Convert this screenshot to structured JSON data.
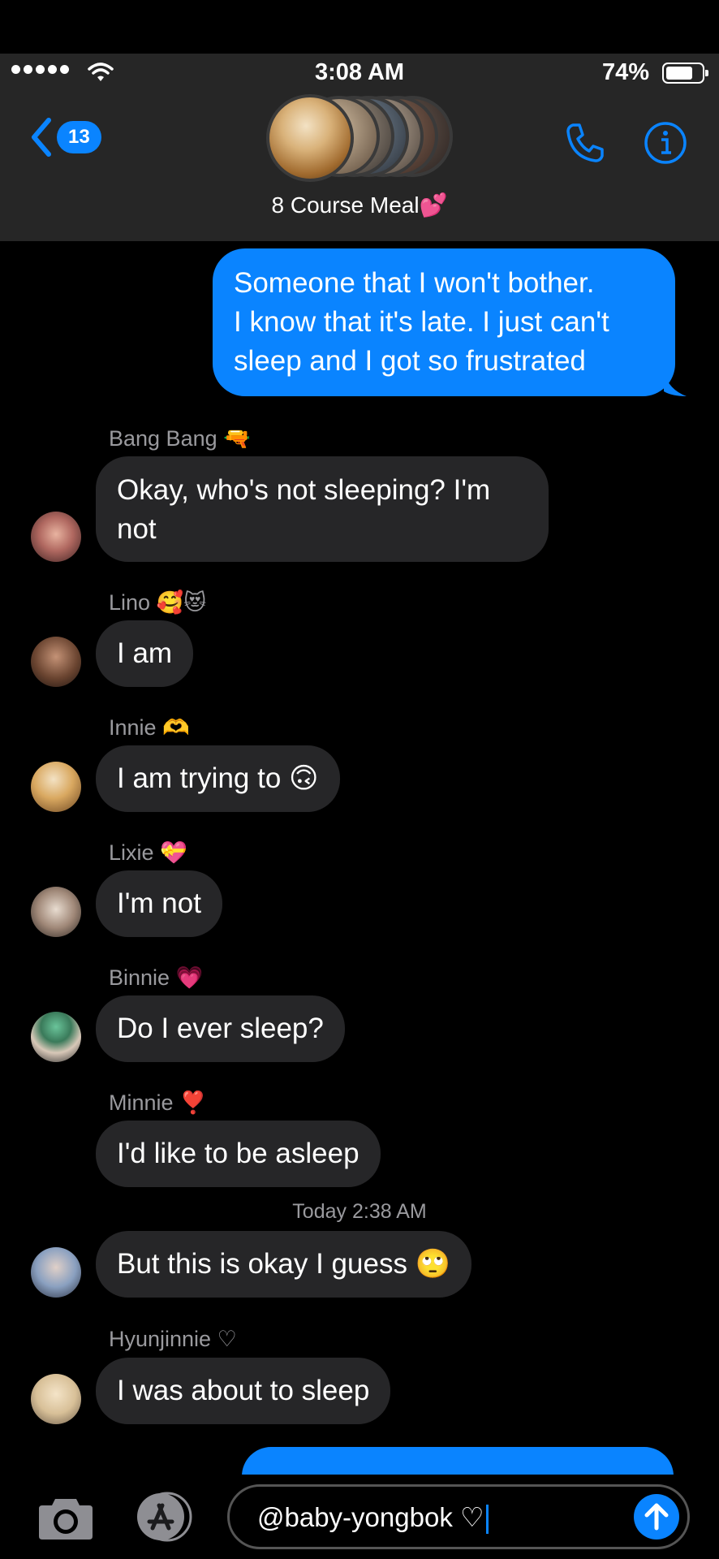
{
  "status_bar": {
    "time": "3:08 AM",
    "battery": "74%",
    "battery_level": 0.74
  },
  "header": {
    "back_count": "13",
    "group_name": "8 Course Meal",
    "group_emoji": "💕",
    "call_icon": "phone-icon",
    "info_icon": "info-icon"
  },
  "messages": [
    {
      "direction": "outgoing",
      "lines": [
        "Someone that I won't bother.",
        "I know that it's late. I just can't",
        "sleep and I got so frustrated"
      ]
    },
    {
      "direction": "incoming",
      "sender": "Bang Bang",
      "sender_emoji": "🔫",
      "lines": [
        "Okay, who's not sleeping? I'm",
        "not"
      ]
    },
    {
      "direction": "incoming",
      "sender": "Lino",
      "sender_emoji": "🥰😻",
      "lines": [
        "I am"
      ]
    },
    {
      "direction": "incoming",
      "sender": "Innie",
      "sender_emoji": "🫶",
      "lines": [
        "I am trying to 🙃"
      ]
    },
    {
      "direction": "incoming",
      "sender": "Lixie",
      "sender_emoji": "💝",
      "lines": [
        "I'm not"
      ]
    },
    {
      "direction": "incoming",
      "sender": "Binnie",
      "sender_emoji": "💗",
      "lines": [
        "Do I ever sleep?"
      ]
    },
    {
      "direction": "incoming",
      "sender": "Minnie",
      "sender_emoji": "❣️",
      "lines": [
        "I'd like to be asleep"
      ]
    },
    {
      "direction": "incoming",
      "sender": "",
      "lines": [
        "But this is okay I guess 🙄"
      ]
    },
    {
      "direction": "incoming",
      "sender": "Hyunjinnie ♡",
      "sender_emoji": "",
      "lines": [
        "I was about to sleep"
      ]
    }
  ],
  "timestamp": {
    "day": "Today",
    "time": "2:38 AM"
  },
  "composer": {
    "text": "@baby-yongbok ♡",
    "camera_icon": "camera-icon",
    "apps_icon": "app-store-icon",
    "send_icon": "send-arrow-icon"
  },
  "colors": {
    "accent": "#0a84ff",
    "incoming_bubble": "#262628",
    "header_bg": "#262626"
  }
}
